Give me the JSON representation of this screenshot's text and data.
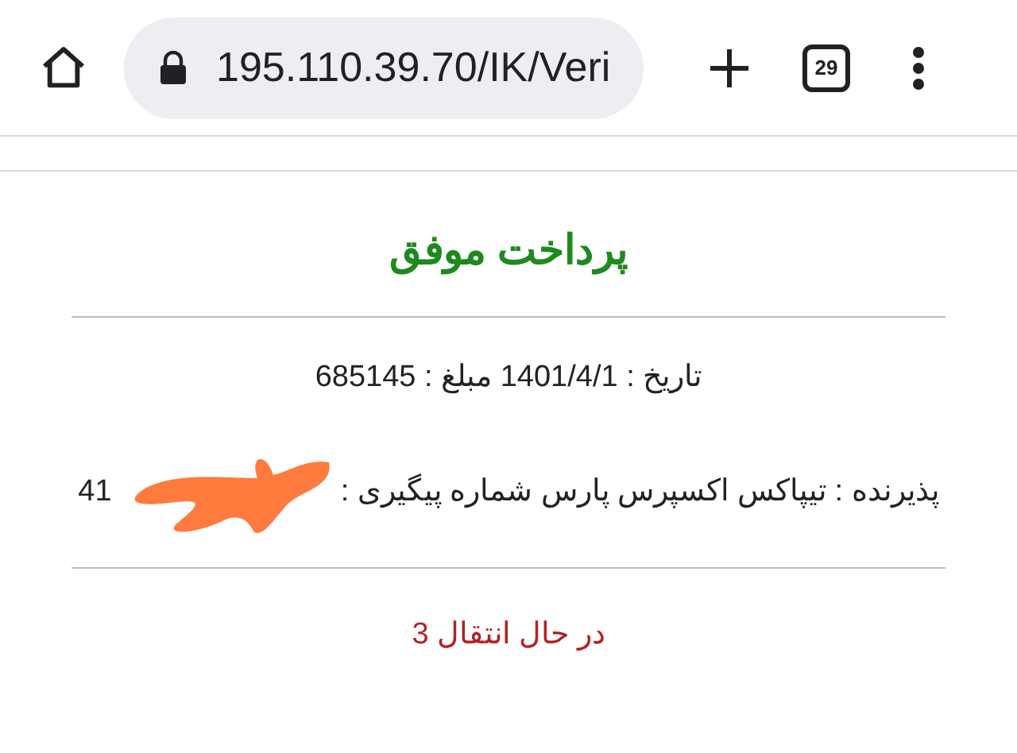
{
  "browser": {
    "url": "195.110.39.70/IK/Veri",
    "tab_count": "29"
  },
  "receipt": {
    "title": "پرداخت موفق",
    "details": "تاریخ : 1401/4/1 مبلغ : 685145",
    "recipient": "پذیرنده : تیپاکس اکسپرس پارس شماره پیگیری :",
    "tracking_visible": "41",
    "status": "در حال انتقال 3"
  }
}
